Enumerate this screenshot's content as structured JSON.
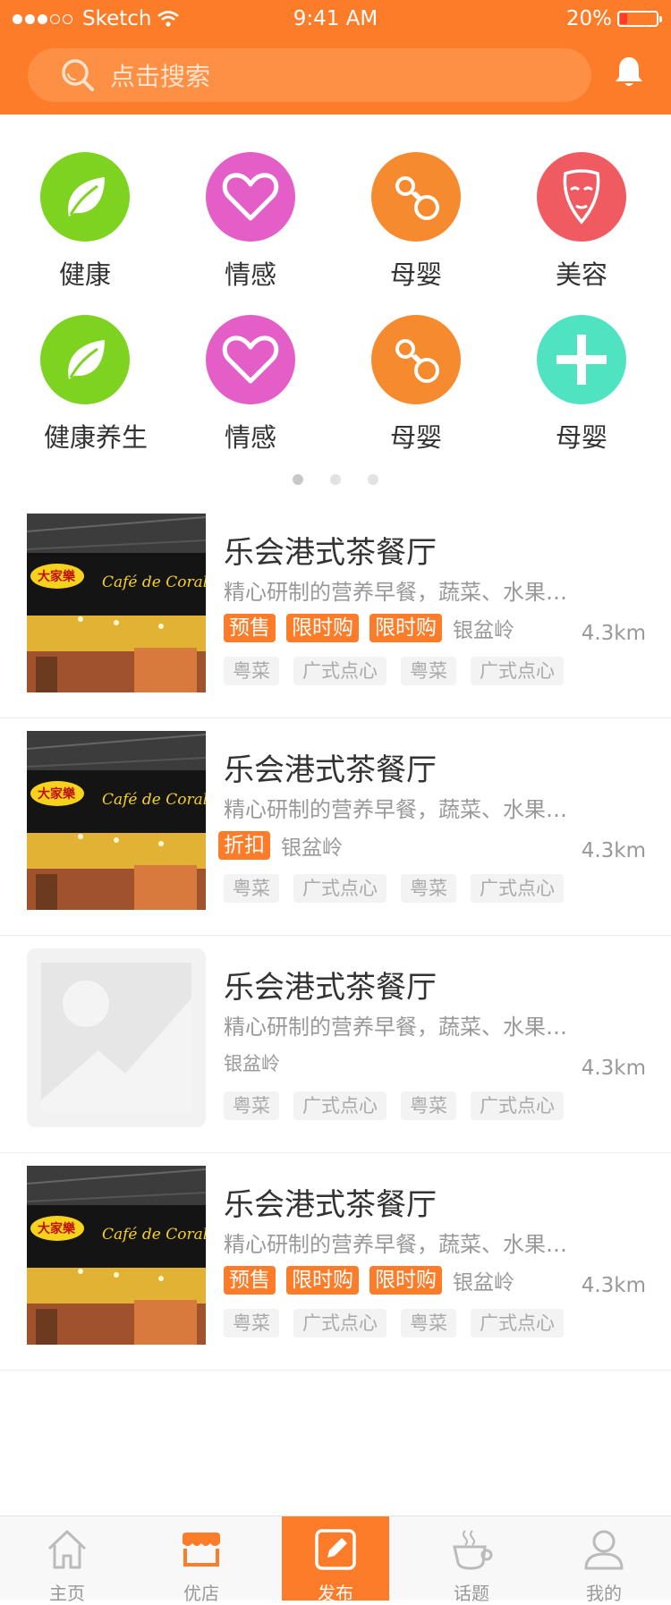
{
  "status_bar": {
    "carrier": "Sketch",
    "time": "9:41 AM",
    "battery": "20%",
    "battery_level": 0.2,
    "signal_dots": [
      true,
      true,
      true,
      false,
      false
    ]
  },
  "search": {
    "placeholder": "点击搜索"
  },
  "icons": {
    "search": "search-icon",
    "bell": "bell-icon"
  },
  "colors": {
    "brand": "#fd7c2a",
    "green": "#7ed321",
    "pink": "#e45ec8",
    "orange": "#f58b2e",
    "red": "#f05b61",
    "teal": "#50e3c2"
  },
  "categories": [
    {
      "label": "健康",
      "icon": "leaf-icon",
      "color": "#7ed321"
    },
    {
      "label": "情感",
      "icon": "heart-icon",
      "color": "#e45ec8"
    },
    {
      "label": "母婴",
      "icon": "pacifier-icon",
      "color": "#f58b2e"
    },
    {
      "label": "美容",
      "icon": "face-mask-icon",
      "color": "#f05b61"
    },
    {
      "label": "健康养生",
      "icon": "leaf-icon",
      "color": "#7ed321"
    },
    {
      "label": "情感",
      "icon": "heart-icon",
      "color": "#e45ec8"
    },
    {
      "label": "母婴",
      "icon": "pacifier-icon",
      "color": "#f58b2e"
    },
    {
      "label": "母婴",
      "icon": "plus-icon",
      "color": "#50e3c2"
    }
  ],
  "pager": {
    "count": 3,
    "active": 0
  },
  "restaurants": [
    {
      "title": "乐会港式茶餐厅",
      "desc": "精心研制的营养早餐，蔬菜、水果…",
      "badges": [
        "预售",
        "限时购",
        "限时购"
      ],
      "location": "银盆岭",
      "distance": "4.3km",
      "tags": [
        "粤菜",
        "广式点心",
        "粤菜",
        "广式点心"
      ],
      "image": "photo",
      "sign": {
        "cn": "大家樂",
        "en": "Café de Coral."
      }
    },
    {
      "title": "乐会港式茶餐厅",
      "desc": "精心研制的营养早餐，蔬菜、水果…",
      "badges": [
        "折扣"
      ],
      "location": "银盆岭",
      "distance": "4.3km",
      "tags": [
        "粤菜",
        "广式点心",
        "粤菜",
        "广式点心"
      ],
      "image": "photo",
      "sign": {
        "cn": "大家樂",
        "en": "Café de Coral."
      }
    },
    {
      "title": "乐会港式茶餐厅",
      "desc": "精心研制的营养早餐，蔬菜、水果…",
      "badges": [],
      "location": "银盆岭",
      "distance": "4.3km",
      "tags": [
        "粤菜",
        "广式点心",
        "粤菜",
        "广式点心"
      ],
      "image": "placeholder"
    },
    {
      "title": "乐会港式茶餐厅",
      "desc": "精心研制的营养早餐，蔬菜、水果…",
      "badges": [
        "预售",
        "限时购",
        "限时购"
      ],
      "location": "银盆岭",
      "distance": "4.3km",
      "tags": [
        "粤菜",
        "广式点心",
        "粤菜",
        "广式点心"
      ],
      "image": "photo",
      "sign": {
        "cn": "大家樂",
        "en": "Café de Coral."
      }
    }
  ],
  "tabbar": [
    {
      "label": "主页",
      "icon": "home-icon"
    },
    {
      "label": "优店",
      "icon": "shop-icon"
    },
    {
      "label": "发布",
      "icon": "edit-icon"
    },
    {
      "label": "话题",
      "icon": "coffee-cup-icon"
    },
    {
      "label": "我的",
      "icon": "user-icon"
    }
  ]
}
